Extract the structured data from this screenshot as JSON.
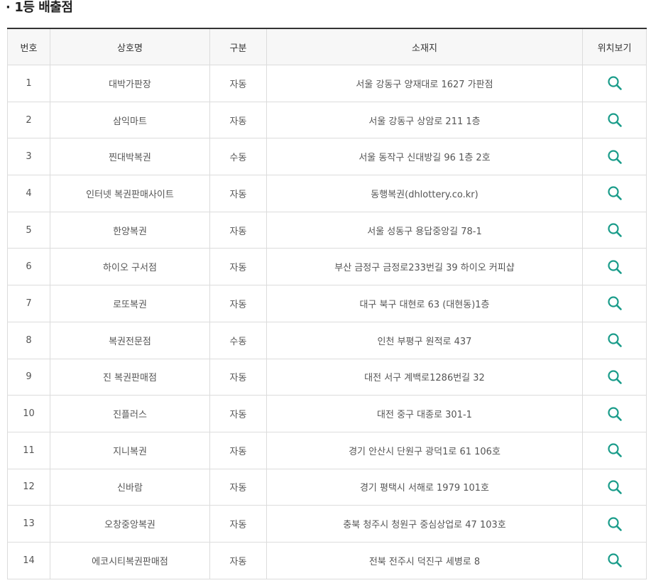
{
  "section": {
    "bullet": "·",
    "title": "1등 배출점"
  },
  "table": {
    "headers": {
      "no": "번호",
      "name": "상호명",
      "type": "구분",
      "address": "소재지",
      "map": "위치보기"
    },
    "rows": [
      {
        "no": "1",
        "name": "대박가판장",
        "type": "자동",
        "address": "서울 강동구 양재대로 1627 가판점"
      },
      {
        "no": "2",
        "name": "삼익마트",
        "type": "자동",
        "address": "서울 강동구 상암로 211 1층"
      },
      {
        "no": "3",
        "name": "찐대박복권",
        "type": "수동",
        "address": "서울 동작구 신대방길 96 1층 2호"
      },
      {
        "no": "4",
        "name": "인터넷 복권판매사이트",
        "type": "자동",
        "address": "동행복권(dhlottery.co.kr)"
      },
      {
        "no": "5",
        "name": "한양복권",
        "type": "자동",
        "address": "서울 성동구 용답중앙길 78-1"
      },
      {
        "no": "6",
        "name": "하이오 구서점",
        "type": "자동",
        "address": "부산 금정구 금정로233번길 39 하이오 커피샵"
      },
      {
        "no": "7",
        "name": "로또복권",
        "type": "자동",
        "address": "대구 북구 대현로 63 (대현동)1층"
      },
      {
        "no": "8",
        "name": "복권전문점",
        "type": "수동",
        "address": "인천 부평구 원적로 437"
      },
      {
        "no": "9",
        "name": "진 복권판매점",
        "type": "자동",
        "address": "대전 서구 계백로1286번길 32"
      },
      {
        "no": "10",
        "name": "진플러스",
        "type": "자동",
        "address": "대전 중구 대종로 301-1"
      },
      {
        "no": "11",
        "name": "지니복권",
        "type": "자동",
        "address": "경기 안산시 단원구 광덕1로 61 106호"
      },
      {
        "no": "12",
        "name": "신바람",
        "type": "자동",
        "address": "경기 평택시 서해로 1979 101호"
      },
      {
        "no": "13",
        "name": "오창중앙복권",
        "type": "자동",
        "address": "충북 청주시 청원구 중심상업로 47 103호"
      },
      {
        "no": "14",
        "name": "에코시티복권판매점",
        "type": "자동",
        "address": "전북 전주시 덕진구 세병로 8"
      }
    ]
  },
  "icons": {
    "map_view": "search-icon"
  },
  "colors": {
    "icon": "#1a9c8a",
    "header_border": "#333333",
    "header_bg": "#f7f7f7",
    "grid": "#dcdcdc"
  }
}
